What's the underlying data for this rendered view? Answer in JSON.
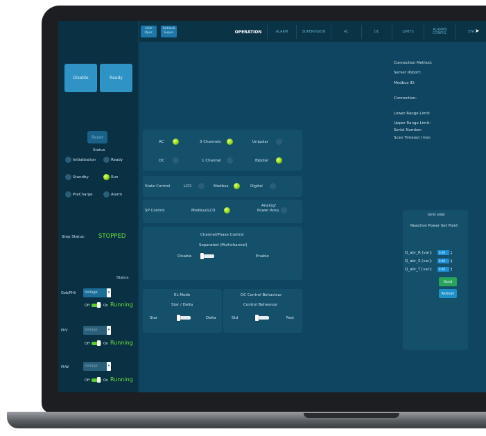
{
  "tabs": {
    "left_buttons": [
      "Hide\nOper.",
      "Unblock\nSuper."
    ],
    "items": [
      "OPERATION",
      "ALARM",
      "SUPERVISION",
      "AC",
      "DC",
      "LIMITS",
      "ALARMS\nCONFIG.",
      "STA"
    ]
  },
  "sidebar": {
    "disable": "Disable",
    "ready": "Ready",
    "reset": "Reset",
    "status_title": "Status",
    "status_items": [
      "Initialization",
      "Ready",
      "Standby",
      "Run",
      "PreCharge",
      "Alarm"
    ],
    "step_status_label": "Step Status:",
    "step_status_value": "STOPPED",
    "status2_title": "Status",
    "rows": [
      {
        "label": "Gob/PHil",
        "select": "Voltage",
        "off": "Off",
        "on": "On",
        "state": "Running"
      },
      {
        "label": "PhV",
        "select": "Voltage",
        "off": "Off",
        "on": "On",
        "state": "Running"
      },
      {
        "label": "PhW",
        "select": "Voltage",
        "off": "Off",
        "on": "On",
        "state": "Running"
      }
    ]
  },
  "config": {
    "ac": "AC",
    "channels3": "3 Channels",
    "unipolar": "Unipolar",
    "dc": "DC",
    "channel1": "1 Channel",
    "bipolar": "Bipolar",
    "state_control": "State Control",
    "lcd": "LCD",
    "modbus": "Modbus",
    "digital": "Digital",
    "sp_control": "SP Control",
    "modbus_lcd": "Modbus/LCD",
    "analog": "Analog/\nPower Amp.",
    "channel_phase_title": "Channel/Phase Control",
    "separated": "Separated (Multichannel)",
    "disable": "Disable",
    "enable": "Enable",
    "el_mode": "EL Mode",
    "star_delta": "Star / Delta",
    "star": "Star",
    "delta": "Delta",
    "dc_behaviour": "DC Control Behaviour",
    "control_behaviour": "Control Behaviour",
    "std": "Std",
    "fast": "Fast"
  },
  "connection": {
    "labels": [
      "Connection Method:",
      "Server IP/port:",
      "Modbus ID:",
      "Connection:",
      "Lower Range Limit:",
      "Upper Range Limit:",
      "Serial Number:",
      "Scan Timeout (ms):"
    ]
  },
  "grid": {
    "title": "Grid side",
    "subtitle": "Reactive Power Set Point",
    "rows": [
      {
        "label": "Q_abr_R [var]:",
        "value": "0.00"
      },
      {
        "label": "Q_abr_S [var]:",
        "value": "0.00"
      },
      {
        "label": "Q_abr_T [var]:",
        "value": "0.00"
      }
    ],
    "send": "Send",
    "refresh": "Refresh"
  },
  "colors": {
    "screen_bg": "#0d3c53",
    "accent_blue": "#2f93c6",
    "led_on": "#8fd618",
    "running": "#6be03a",
    "send": "#2aa45a"
  }
}
